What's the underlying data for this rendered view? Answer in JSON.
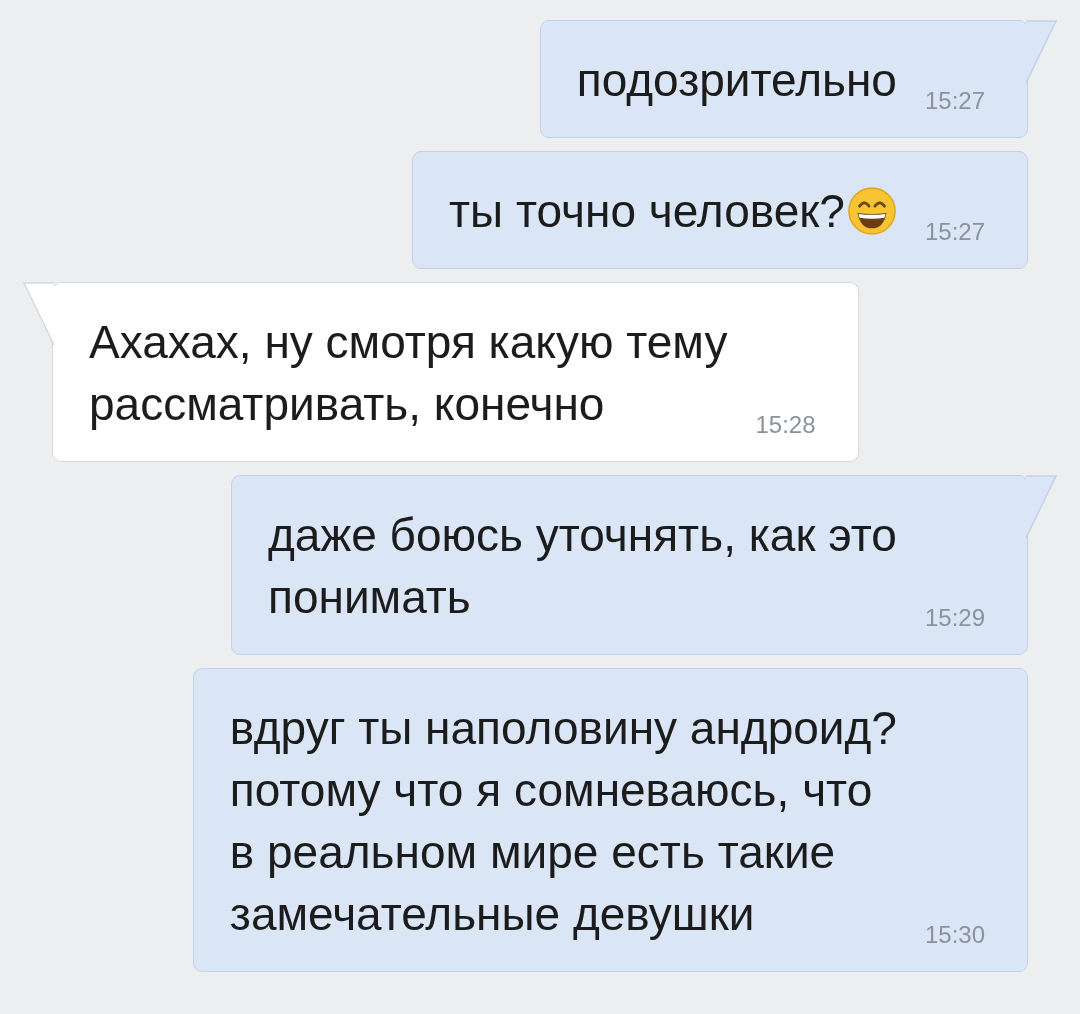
{
  "messages": [
    {
      "kind": "outgoing",
      "tail": true,
      "emoji_after": false,
      "lines": [
        "подозрительно"
      ],
      "time": "15:27"
    },
    {
      "kind": "outgoing",
      "tail": false,
      "emoji_after": true,
      "lines": [
        "ты точно человек?"
      ],
      "time": "15:27"
    },
    {
      "kind": "incoming",
      "tail": true,
      "emoji_after": false,
      "lines": [
        "Ахахах, ну смотря какую тему",
        "рассматривать, конечно"
      ],
      "time": "15:28"
    },
    {
      "kind": "outgoing",
      "tail": true,
      "emoji_after": false,
      "lines": [
        "даже боюсь уточнять, как это",
        "понимать"
      ],
      "time": "15:29"
    },
    {
      "kind": "outgoing",
      "tail": false,
      "emoji_after": false,
      "lines": [
        "вдруг ты наполовину андроид?",
        "потому что я сомневаюсь, что",
        "в реальном мире есть такие",
        "замечательные девушки"
      ],
      "time": "15:30"
    }
  ]
}
